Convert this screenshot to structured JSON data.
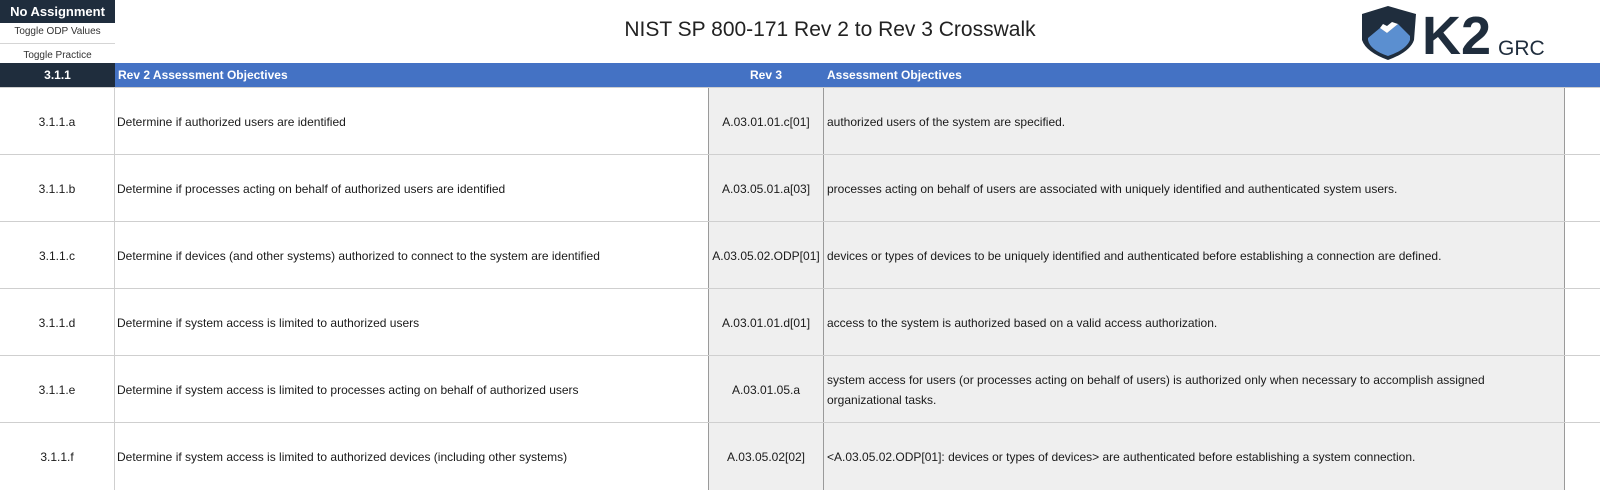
{
  "top": {
    "assignment": "No Assignment",
    "toggle_odp": "Toggle ODP Values",
    "toggle_practice": "Toggle Practice",
    "title": "NIST SP 800-171 Rev 2 to Rev 3 Crosswalk",
    "logo_text": "K2",
    "logo_sub": "GRC"
  },
  "header": {
    "control_id": "3.1.1",
    "rev2_label": "Rev 2 Assessment Objectives",
    "rev3_label": "Rev 3",
    "objectives_label": "Assessment Objectives"
  },
  "rows": [
    {
      "id": "3.1.1.a",
      "rev2": "Determine if authorized users are identified",
      "rev3": "A.03.01.01.c[01]",
      "objective": "authorized users of the system are specified."
    },
    {
      "id": "3.1.1.b",
      "rev2": "Determine if processes acting on behalf of authorized users are identified",
      "rev3": "A.03.05.01.a[03]",
      "objective": "processes acting on behalf of users are associated with uniquely identified and authenticated system users."
    },
    {
      "id": "3.1.1.c",
      "rev2": "Determine if devices (and other systems) authorized to connect to the system are identified",
      "rev3": "A.03.05.02.ODP[01]",
      "objective": "devices or types of devices to be uniquely identified and authenticated before establishing a connection are defined."
    },
    {
      "id": "3.1.1.d",
      "rev2": "Determine if system access is limited to authorized users",
      "rev3": "A.03.01.01.d[01]",
      "objective": "access to the system is authorized based on a valid access authorization."
    },
    {
      "id": "3.1.1.e",
      "rev2": "Determine if system access is limited to processes acting on behalf of authorized users",
      "rev3": "A.03.01.05.a",
      "objective": "system access for users (or processes acting on behalf of users) is authorized only when necessary to accomplish assigned organizational tasks."
    },
    {
      "id": "3.1.1.f",
      "rev2": "Determine if system access is limited to authorized devices (including other systems)",
      "rev3": "A.03.05.02[02]",
      "objective": "<A.03.05.02.ODP[01]: devices or types of devices> are authenticated before establishing a system connection."
    }
  ],
  "colors": {
    "header_blue": "#4472c4",
    "dark_navy": "#1f2d3d",
    "rev3_bg": "#efefef"
  }
}
